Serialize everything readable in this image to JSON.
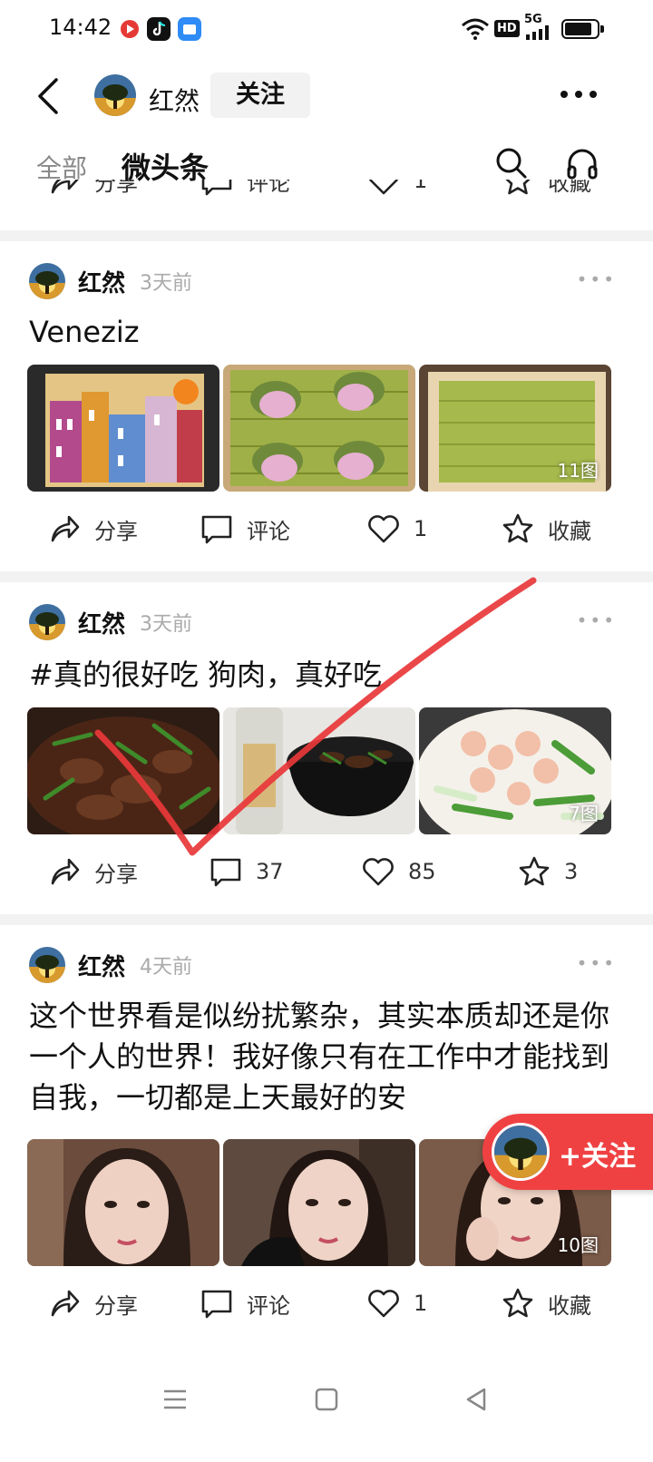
{
  "status_bar": {
    "time": "14:42",
    "hd": "HD",
    "network": "5G",
    "battery_level": 0.85
  },
  "header": {
    "title": "红然",
    "follow_label": "关注"
  },
  "tabs": [
    {
      "label": "全部"
    },
    {
      "label": "微头条"
    }
  ],
  "prev_actions": {
    "share": "分享",
    "comment": "评论",
    "like": "1",
    "fav": "收藏"
  },
  "posts": [
    {
      "author": "红然",
      "time": "3天前",
      "text": "Veneziz",
      "image_count": "11图",
      "actions": {
        "share": "分享",
        "comment": "评论",
        "like": "1",
        "fav": "收藏"
      }
    },
    {
      "author": "红然",
      "time": "3天前",
      "text": "#真的很好吃 狗肉，真好吃",
      "image_count": "7图",
      "actions": {
        "share": "分享",
        "comment": "37",
        "like": "85",
        "fav": "3"
      }
    },
    {
      "author": "红然",
      "time": "4天前",
      "text": "这个世界看是似纷扰繁杂，其实本质却还是你一个人的世界！我好像只有在工作中才能找到自我，一切都是上天最好的安",
      "image_count": "10图",
      "actions": {
        "share": "分享",
        "comment": "评论",
        "like": "1",
        "fav": "收藏"
      }
    }
  ],
  "floating_follow": {
    "label": "+关注"
  },
  "colors": {
    "accent_red": "#f04142",
    "divider": "#f2f2f2",
    "annotation_red": "#e8373a"
  }
}
